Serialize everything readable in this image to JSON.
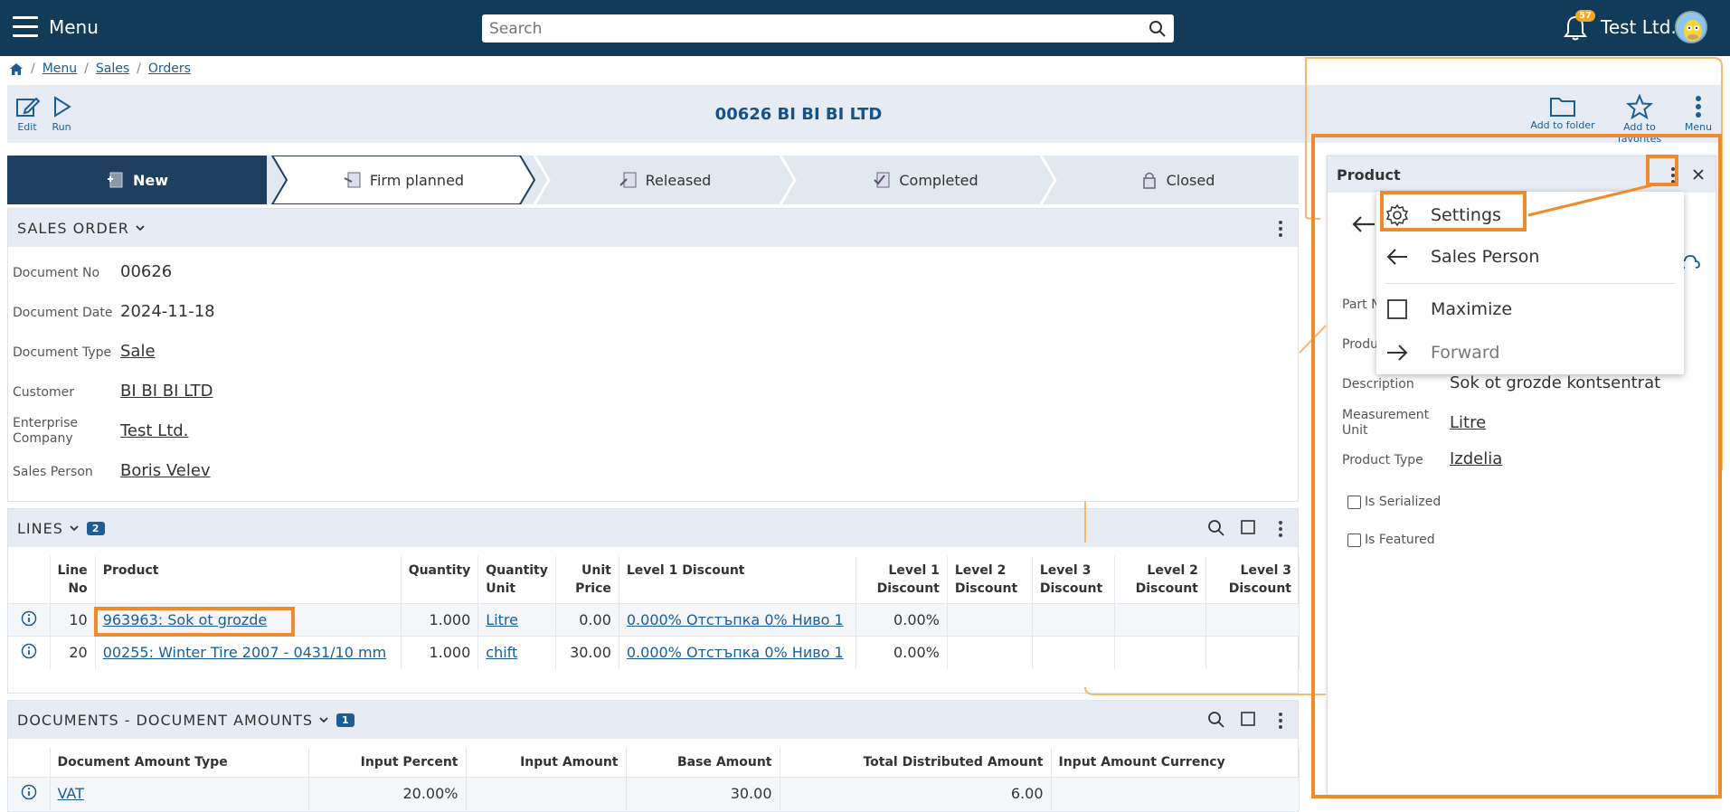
{
  "topbar": {
    "menu_label": "Menu",
    "search_placeholder": "Search",
    "notification_count": "57",
    "company_name": "Test Ltd."
  },
  "breadcrumb": [
    "Menu",
    "Sales",
    "Orders"
  ],
  "toolbar": {
    "edit_label": "Edit",
    "run_label": "Run",
    "add_folder_label": "Add to folder",
    "add_favorites_label": "Add to favorites",
    "menu_label": "Menu"
  },
  "document_title": "00626 BI BI BI LTD",
  "steps": [
    "New",
    "Firm planned",
    "Released",
    "Completed",
    "Closed"
  ],
  "sales_order": {
    "header": "SALES ORDER",
    "fields": [
      {
        "label": "Document No",
        "value": "00626"
      },
      {
        "label": "Document Date",
        "value": "2024-11-18"
      },
      {
        "label": "Document Type",
        "value": "Sale"
      },
      {
        "label": "Customer",
        "value": "BI BI BI LTD"
      },
      {
        "label": "Enterprise Company",
        "value": "Test Ltd."
      },
      {
        "label": "Sales Person",
        "value": "Boris Velev"
      }
    ]
  },
  "lines": {
    "header": "LINES",
    "count": "2",
    "columns": [
      "Line No",
      "Product",
      "Quantity",
      "Quantity Unit",
      "Unit Price",
      "Level 1 Discount",
      "Level 1 Discount",
      "Level 2 Discount",
      "Level 3 Discount",
      "Level 2 Discount",
      "Level 3 Discount"
    ],
    "rows": [
      {
        "line_no": "10",
        "product": "963963: Sok ot grozde",
        "quantity": "1.000",
        "unit": "Litre",
        "unit_price": "0.00",
        "level1_discount": "0.000% Отстъпка 0% Ниво 1",
        "level1_pct": "0.00%"
      },
      {
        "line_no": "20",
        "product": "00255: Winter Tire 2007 - 0431/10 mm",
        "quantity": "1.000",
        "unit": "chift",
        "unit_price": "30.00",
        "level1_discount": "0.000% Отстъпка 0% Ниво 1",
        "level1_pct": "0.00%"
      }
    ]
  },
  "documents": {
    "header": "DOCUMENTS - DOCUMENT AMOUNTS",
    "count": "1",
    "columns": [
      "Document Amount Type",
      "Input Percent",
      "Input Amount",
      "Base Amount",
      "Total Distributed Amount",
      "Input Amount Currency"
    ],
    "rows": [
      {
        "type": "VAT",
        "input_percent": "20.00%",
        "input_amount": "",
        "base_amount": "30.00",
        "total_distributed": "6.00",
        "currency": ""
      }
    ]
  },
  "product_panel": {
    "title": "Product",
    "fields": [
      {
        "label": "Part N",
        "value": ""
      },
      {
        "label": "Produ",
        "value": ""
      },
      {
        "label": "Description",
        "value": "Sok ot grozde kontsentrat"
      },
      {
        "label": "Measurement Unit",
        "value": "Litre"
      },
      {
        "label": "Product Type",
        "value": "Izdelia"
      }
    ],
    "checkboxes": [
      "Is Serialized",
      "Is Featured"
    ]
  },
  "dropdown_menu": {
    "items": [
      "Settings",
      "Sales Person",
      "Maximize",
      "Forward"
    ]
  },
  "colors": {
    "topbar": "#123a59",
    "accent": "#1b5d94",
    "highlight": "#f08a2c",
    "active_step": "#1e3f5f"
  }
}
